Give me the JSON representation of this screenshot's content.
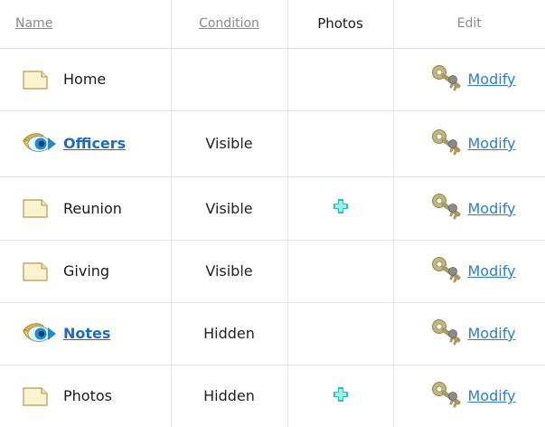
{
  "columns": {
    "name": "Name",
    "condition": "Condition",
    "photos": "Photos",
    "edit": "Edit"
  },
  "rows": [
    {
      "name": "Home",
      "kind": "page",
      "condition": "",
      "has_photo": false,
      "edit": "Modify"
    },
    {
      "name": "Officers",
      "kind": "section",
      "condition": "Visible",
      "has_photo": false,
      "edit": "Modify"
    },
    {
      "name": "Reunion",
      "kind": "page",
      "condition": "Visible",
      "has_photo": true,
      "edit": "Modify"
    },
    {
      "name": "Giving",
      "kind": "page",
      "condition": "Visible",
      "has_photo": false,
      "edit": "Modify"
    },
    {
      "name": "Notes",
      "kind": "section",
      "condition": "Hidden",
      "has_photo": false,
      "edit": "Modify"
    },
    {
      "name": "Photos",
      "kind": "page",
      "condition": "Hidden",
      "has_photo": true,
      "edit": "Modify"
    }
  ],
  "icons": {
    "page": "page-icon",
    "section": "eye-icon",
    "photo": "add-photo-icon",
    "edit": "key-icon"
  },
  "colors": {
    "link": "#2a7fd0",
    "section_link": "#1a6cc7",
    "grid": "#e6e6e6"
  }
}
